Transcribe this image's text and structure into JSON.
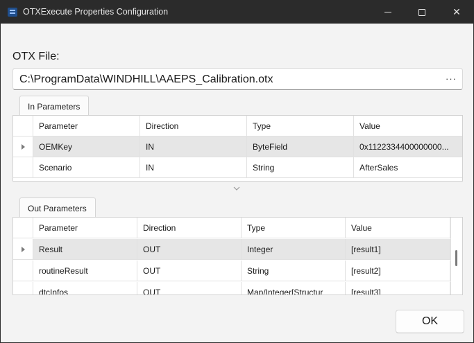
{
  "window": {
    "title": "OTXExecute Properties Configuration",
    "controls": {
      "minimize": "minimize",
      "maximize": "maximize",
      "close": "✕"
    }
  },
  "otx_file": {
    "label": "OTX File:",
    "value": "C:\\ProgramData\\WINDHILL\\AAEPS_Calibration.otx",
    "browse_label": "···"
  },
  "in_parameters": {
    "tab_label": "In Parameters",
    "columns": [
      "Parameter",
      "Direction",
      "Type",
      "Value"
    ],
    "rows": [
      {
        "parameter": "OEMKey",
        "direction": "IN",
        "type": "ByteField",
        "value": "0x1122334400000000...",
        "selected": true
      },
      {
        "parameter": "Scenario",
        "direction": "IN",
        "type": "String",
        "value": "AfterSales",
        "selected": false
      }
    ]
  },
  "out_parameters": {
    "tab_label": "Out Parameters",
    "columns": [
      "Parameter",
      "Direction",
      "Type",
      "Value"
    ],
    "rows": [
      {
        "parameter": "Result",
        "direction": "OUT",
        "type": "Integer",
        "value": "[result1]",
        "selected": true
      },
      {
        "parameter": "routineResult",
        "direction": "OUT",
        "type": "String",
        "value": "[result2]",
        "selected": false
      },
      {
        "parameter": "dtcInfos",
        "direction": "OUT",
        "type": "Map/Integer[Structur",
        "value": "[result3]",
        "selected": false
      }
    ]
  },
  "buttons": {
    "ok_label": "OK"
  },
  "colors": {
    "titlebar": "#2b2b2b",
    "selected_row": "#e6e6e6",
    "window_bg": "#f3f3f3"
  }
}
